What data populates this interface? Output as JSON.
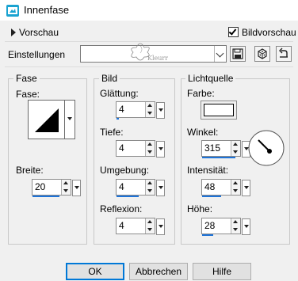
{
  "window": {
    "title": "Innenfase"
  },
  "toolbar": {
    "preview_toggle_label": "Vorschau",
    "live_preview_label": "Bildvorschau",
    "live_preview_checked": true,
    "settings_label": "Einstellungen",
    "settings_value": ""
  },
  "fase": {
    "group_label": "Fase",
    "fase_label": "Fase:",
    "breite_label": "Breite:",
    "breite_value": "20"
  },
  "bild": {
    "group_label": "Bild",
    "glaettung_label": "Glättung:",
    "glaettung_value": "4",
    "tiefe_label": "Tiefe:",
    "tiefe_value": "4",
    "umgebung_label": "Umgebung:",
    "umgebung_value": "4",
    "reflexion_label": "Reflexion:",
    "reflexion_value": "4"
  },
  "lichtquelle": {
    "group_label": "Lichtquelle",
    "farbe_label": "Farbe:",
    "farbe_value": "#ffffff",
    "winkel_label": "Winkel:",
    "winkel_value": "315",
    "intensitaet_label": "Intensität:",
    "intensitaet_value": "48",
    "hoehe_label": "Höhe:",
    "hoehe_value": "28"
  },
  "buttons": {
    "ok": "OK",
    "cancel": "Abbrechen",
    "help": "Hilfe"
  },
  "colors": {
    "accent": "#0078d7",
    "slider": "#1e73d8"
  }
}
